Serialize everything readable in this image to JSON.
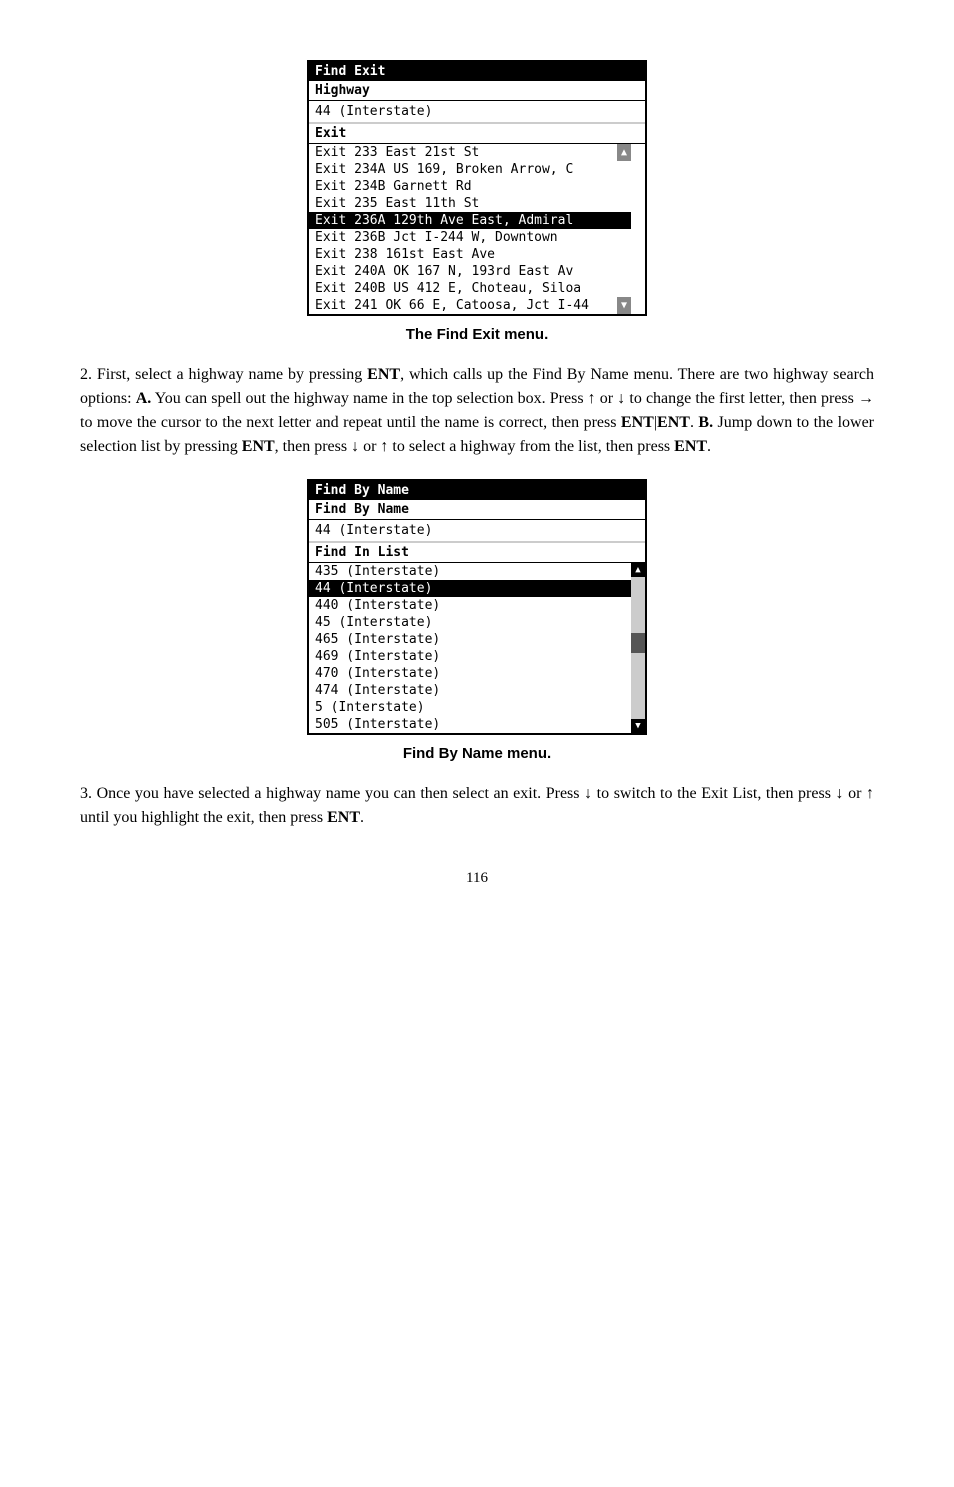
{
  "page": {
    "number": "116"
  },
  "menu1": {
    "title": "Find Exit",
    "section_label": "Highway",
    "field_value": "44 (Interstate)",
    "exit_label": "Exit",
    "items": [
      {
        "text": "Exit 233 East 21st St",
        "highlighted": false,
        "scroll_indicator": true
      },
      {
        "text": "Exit 234A US 169, Broken Arrow, C",
        "highlighted": false,
        "scroll_indicator": false
      },
      {
        "text": "Exit 234B Garnett Rd",
        "highlighted": false,
        "scroll_indicator": false
      },
      {
        "text": "Exit 235 East 11th St",
        "highlighted": false,
        "scroll_indicator": false
      },
      {
        "text": "Exit 236A 129th Ave East, Admiral",
        "highlighted": true,
        "scroll_indicator": false
      },
      {
        "text": "Exit 236B Jct I-244 W, Downtown",
        "highlighted": false,
        "scroll_indicator": false
      },
      {
        "text": "Exit 238 161st East Ave",
        "highlighted": false,
        "scroll_indicator": false
      },
      {
        "text": "Exit 240A OK 167 N, 193rd East Av",
        "highlighted": false,
        "scroll_indicator": false
      },
      {
        "text": "Exit 240B US 412 E, Choteau, Siloa",
        "highlighted": false,
        "scroll_indicator": false
      },
      {
        "text": "Exit 241 OK 66 E, Catoosa, Jct I-44",
        "highlighted": false,
        "scroll_indicator": true
      }
    ]
  },
  "caption1": "The Find Exit menu.",
  "paragraph2": {
    "number": "2.",
    "text_before_ent": "First, select a highway name by pressing ",
    "ent1": "ENT",
    "text_after_ent1": ", which calls up the Find By Name menu. There are two highway search options: ",
    "A": "A.",
    "text_A": " You can spell out the highway name in the top selection box. Press ↑ or ↓ to change the first letter, then press → to move the cursor to the next letter and repeat until the name is correct, then press ",
    "ent2": "ENT",
    "separator": "|",
    "ent3": "ENT",
    "text_B_intro": ". ",
    "B": "B.",
    "text_B": " Jump down to the lower selection list by pressing ",
    "ent4": "ENT",
    "text_B2": ", then press ↓ or ↑ to select a highway from the list, then press ",
    "ent5": "ENT",
    "text_end": "."
  },
  "menu2": {
    "title": "Find By Name",
    "section_label": "Find By Name",
    "field_value": "44 (Interstate)",
    "find_in_list_label": "Find In List",
    "items": [
      {
        "text": "435 (Interstate)",
        "highlighted": false,
        "scroll_up": true
      },
      {
        "text": "44 (Interstate)",
        "highlighted": true
      },
      {
        "text": "440 (Interstate)",
        "highlighted": false
      },
      {
        "text": "45 (Interstate)",
        "highlighted": false
      },
      {
        "text": "465 (Interstate)",
        "highlighted": false
      },
      {
        "text": "469 (Interstate)",
        "highlighted": false,
        "scroll_indicator": true
      },
      {
        "text": "470 (Interstate)",
        "highlighted": false
      },
      {
        "text": "474 (Interstate)",
        "highlighted": false
      },
      {
        "text": "5 (Interstate)",
        "highlighted": false
      },
      {
        "text": "505 (Interstate)",
        "highlighted": false,
        "scroll_down": true
      }
    ]
  },
  "caption2": "Find By Name menu.",
  "paragraph3": {
    "number": "3.",
    "text": " Once you have selected a highway name you can then select an exit. Press ↓ to switch to the Exit List, then press ↓ or ↑ until you highlight the exit, then press ",
    "ent": "ENT",
    "text_end": "."
  }
}
